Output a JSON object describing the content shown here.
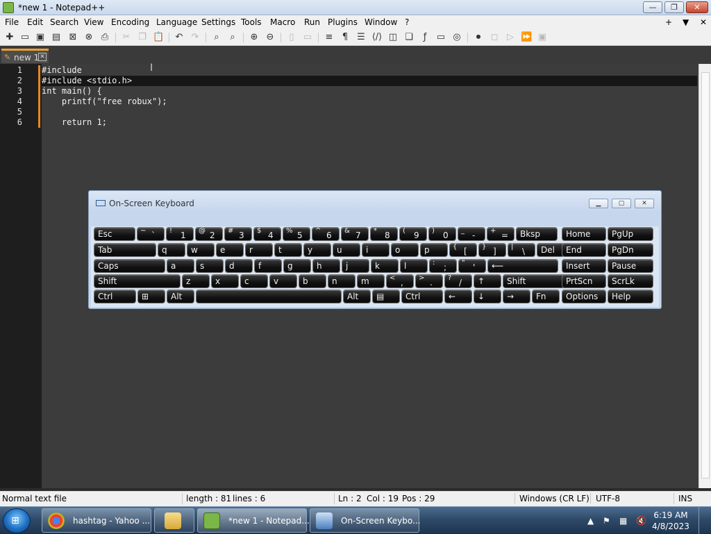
{
  "window": {
    "title": "*new 1 - Notepad++",
    "min": "—",
    "max": "❐",
    "close": "✕"
  },
  "menu": {
    "items": [
      "File",
      "Edit",
      "Search",
      "View",
      "Encoding",
      "Language",
      "Settings",
      "Tools",
      "Macro",
      "Run",
      "Plugins",
      "Window",
      "?"
    ],
    "right": [
      "+",
      "▼",
      "✕"
    ]
  },
  "tab": {
    "label": "new 1",
    "close": "✕"
  },
  "editor": {
    "line_numbers": [
      "1",
      "2",
      "3",
      "4",
      "5",
      "6"
    ],
    "lines": [
      "#include",
      "#include <stdio.h>",
      "int main() {",
      "    printf(\"free robux\");",
      "",
      "    return 1;"
    ]
  },
  "osk": {
    "title": "On-Screen Keyboard",
    "rows": [
      [
        {
          "k": "Esc"
        },
        {
          "s": "~",
          "m": "`"
        },
        {
          "s": "!",
          "m": "1"
        },
        {
          "s": "@",
          "m": "2"
        },
        {
          "s": "#",
          "m": "3"
        },
        {
          "s": "$",
          "m": "4"
        },
        {
          "s": "%",
          "m": "5"
        },
        {
          "s": "^",
          "m": "6"
        },
        {
          "s": "&",
          "m": "7"
        },
        {
          "s": "*",
          "m": "8"
        },
        {
          "s": "(",
          "m": "9"
        },
        {
          "s": ")",
          "m": "0"
        },
        {
          "s": "_",
          "m": "-"
        },
        {
          "s": "+",
          "m": "="
        },
        {
          "k": "Bksp"
        },
        {
          "k": "Home"
        },
        {
          "k": "PgUp"
        }
      ],
      [
        {
          "k": "Tab"
        },
        {
          "k": "q"
        },
        {
          "k": "w"
        },
        {
          "k": "e"
        },
        {
          "k": "r"
        },
        {
          "k": "t"
        },
        {
          "k": "y"
        },
        {
          "k": "u"
        },
        {
          "k": "i"
        },
        {
          "k": "o"
        },
        {
          "k": "p"
        },
        {
          "s": "{",
          "m": "["
        },
        {
          "s": "}",
          "m": "]"
        },
        {
          "s": "|",
          "m": "\\"
        },
        {
          "k": "Del"
        },
        {
          "k": "End"
        },
        {
          "k": "PgDn"
        }
      ],
      [
        {
          "k": "Caps"
        },
        {
          "k": "a"
        },
        {
          "k": "s"
        },
        {
          "k": "d"
        },
        {
          "k": "f"
        },
        {
          "k": "g"
        },
        {
          "k": "h"
        },
        {
          "k": "j"
        },
        {
          "k": "k"
        },
        {
          "k": "l"
        },
        {
          "s": ":",
          "m": ";"
        },
        {
          "s": "\"",
          "m": "'"
        },
        {
          "k": "⟵"
        },
        {
          "k": "Insert"
        },
        {
          "k": "Pause"
        }
      ],
      [
        {
          "k": "Shift"
        },
        {
          "k": "z"
        },
        {
          "k": "x"
        },
        {
          "k": "c"
        },
        {
          "k": "v"
        },
        {
          "k": "b"
        },
        {
          "k": "n"
        },
        {
          "k": "m"
        },
        {
          "s": "<",
          "m": ","
        },
        {
          "s": ">",
          "m": "."
        },
        {
          "s": "?",
          "m": "/"
        },
        {
          "k": "↑"
        },
        {
          "k": "Shift"
        },
        {
          "k": "PrtScn"
        },
        {
          "k": "ScrLk"
        }
      ],
      [
        {
          "k": "Ctrl"
        },
        {
          "k": "⊞"
        },
        {
          "k": "Alt"
        },
        {
          "k": ""
        },
        {
          "k": "Alt"
        },
        {
          "k": "▤"
        },
        {
          "k": "Ctrl"
        },
        {
          "k": "←"
        },
        {
          "k": "↓"
        },
        {
          "k": "→"
        },
        {
          "k": "Fn"
        },
        {
          "k": "Options"
        },
        {
          "k": "Help"
        }
      ]
    ]
  },
  "status": {
    "type": "Normal text file",
    "length": "length : 81",
    "lines": "lines : 6",
    "ln": "Ln : 2",
    "col": "Col : 19",
    "pos": "Pos : 29",
    "eol": "Windows (CR LF)",
    "encoding": "UTF-8",
    "mode": "INS"
  },
  "taskbar": {
    "tasks": [
      {
        "label": "hashtag - Yahoo ...",
        "color": "#e8b400"
      },
      {
        "label": "",
        "color": "#e6c35c"
      },
      {
        "label": "*new 1 - Notepad...",
        "color": "#7ab648"
      },
      {
        "label": "On-Screen Keybo...",
        "color": "#4a7fc0"
      }
    ],
    "time": "6:19 AM",
    "date": "4/8/2023"
  },
  "colors": {
    "accent": "#e8861f",
    "editor_bg": "#3c3c3c",
    "gutter_bg": "#1e1e1e"
  }
}
